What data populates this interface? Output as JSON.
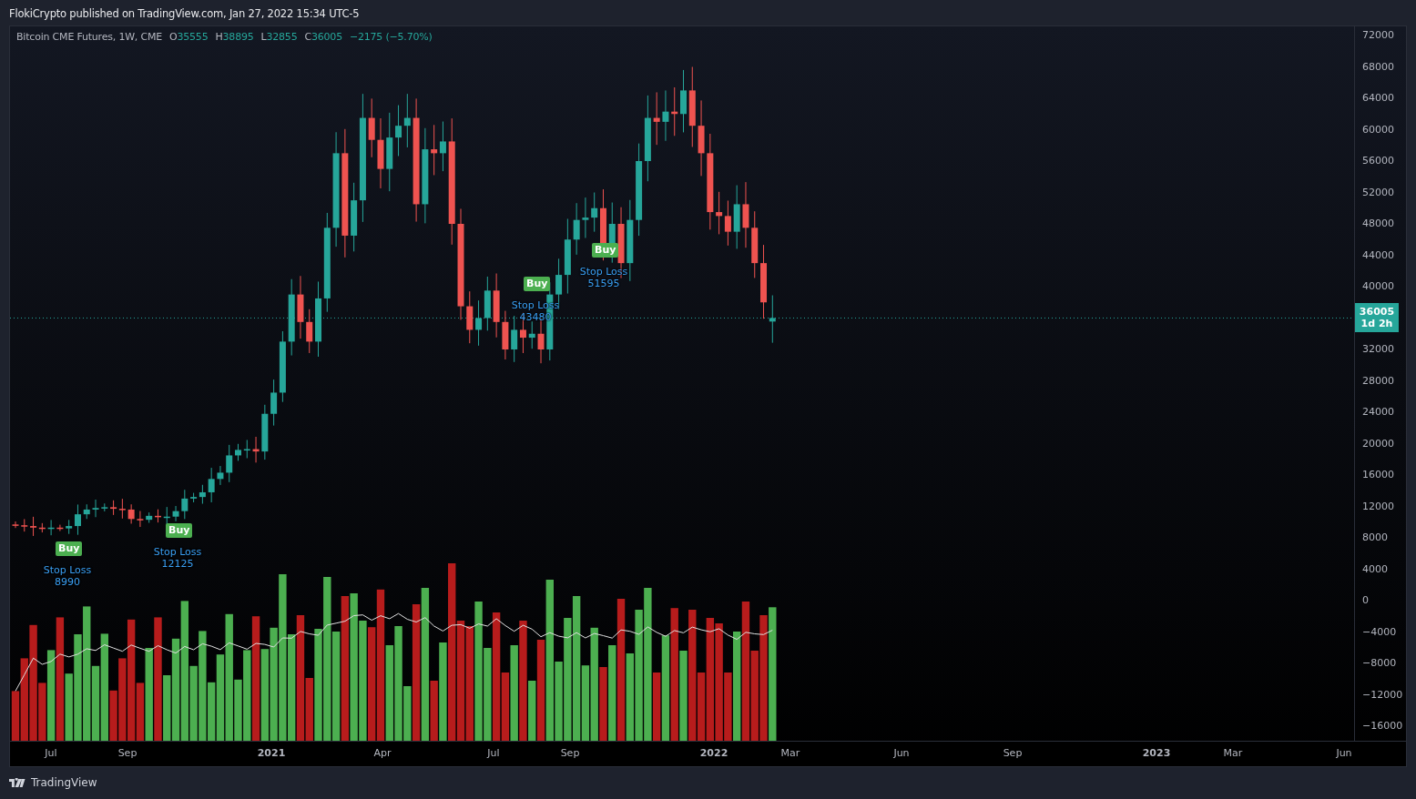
{
  "header": {
    "text": "FlokiCrypto published on TradingView.com, Jan 27, 2022 15:34 UTC-5"
  },
  "legend": {
    "symbol": "Bitcoin CME Futures, 1W, CME",
    "values": [
      {
        "key": "O",
        "value": "35555"
      },
      {
        "key": "H",
        "value": "38895"
      },
      {
        "key": "L",
        "value": "32855"
      },
      {
        "key": "C",
        "value": "36005"
      }
    ],
    "change": "−2175 (−5.70%)"
  },
  "price_axis": [
    "72000",
    "68000",
    "64000",
    "60000",
    "56000",
    "52000",
    "48000",
    "44000",
    "40000",
    "32000",
    "28000",
    "24000",
    "20000",
    "16000",
    "12000",
    "8000",
    "4000",
    "0",
    "−4000",
    "−8000",
    "−12000",
    "−16000"
  ],
  "last_price": {
    "value": "36005",
    "countdown": "1d 2h"
  },
  "time_axis": [
    "Jul",
    "Sep",
    "2021",
    "Apr",
    "Jul",
    "Sep",
    "2022",
    "Mar",
    "Jun",
    "Sep",
    "2023",
    "Mar",
    "Jun"
  ],
  "signals": [
    {
      "label": "Buy",
      "stop_label": "Stop Loss",
      "stop_value": "8990"
    },
    {
      "label": "Buy",
      "stop_label": "Stop Loss",
      "stop_value": "12125"
    },
    {
      "label": "Buy",
      "stop_label": "Stop Loss",
      "stop_value": "43480"
    },
    {
      "label": "Buy",
      "stop_label": "Stop Loss",
      "stop_value": "51595"
    }
  ],
  "footer": {
    "brand": "TradingView"
  }
}
